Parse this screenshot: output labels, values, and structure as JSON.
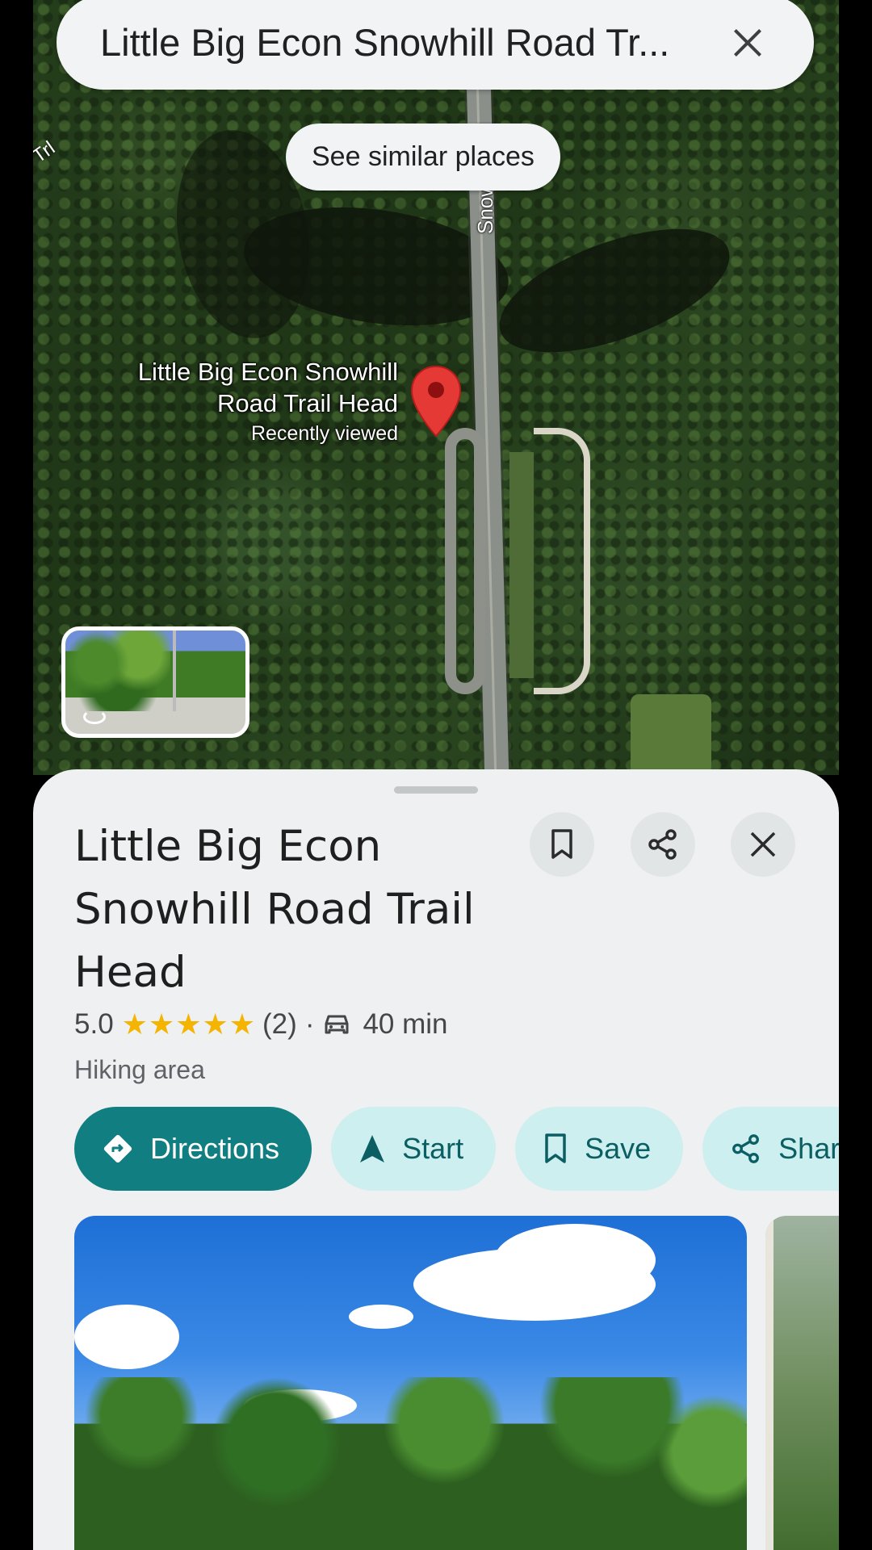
{
  "search": {
    "query": "Little Big Econ Snowhill Road Tr..."
  },
  "map": {
    "similar_places_label": "See similar places",
    "road_label": "Snowhill Rd",
    "trail_label": "Trl",
    "pin_name_line1": "Little Big Econ Snowhill",
    "pin_name_line2": "Road Trail Head",
    "pin_status": "Recently viewed"
  },
  "place": {
    "title": "Little Big Econ Snowhill Road Trail Head",
    "rating": "5.0",
    "stars": "★★★★★",
    "review_count": "(2)",
    "separator": "·",
    "drive_time": "40 min",
    "category": "Hiking area"
  },
  "actions": {
    "directions": "Directions",
    "start": "Start",
    "save": "Save",
    "share": "Share"
  },
  "colors": {
    "accent": "#117e82",
    "chip_bg": "#cdeff0",
    "star": "#f4b400",
    "pin": "#e53935"
  }
}
